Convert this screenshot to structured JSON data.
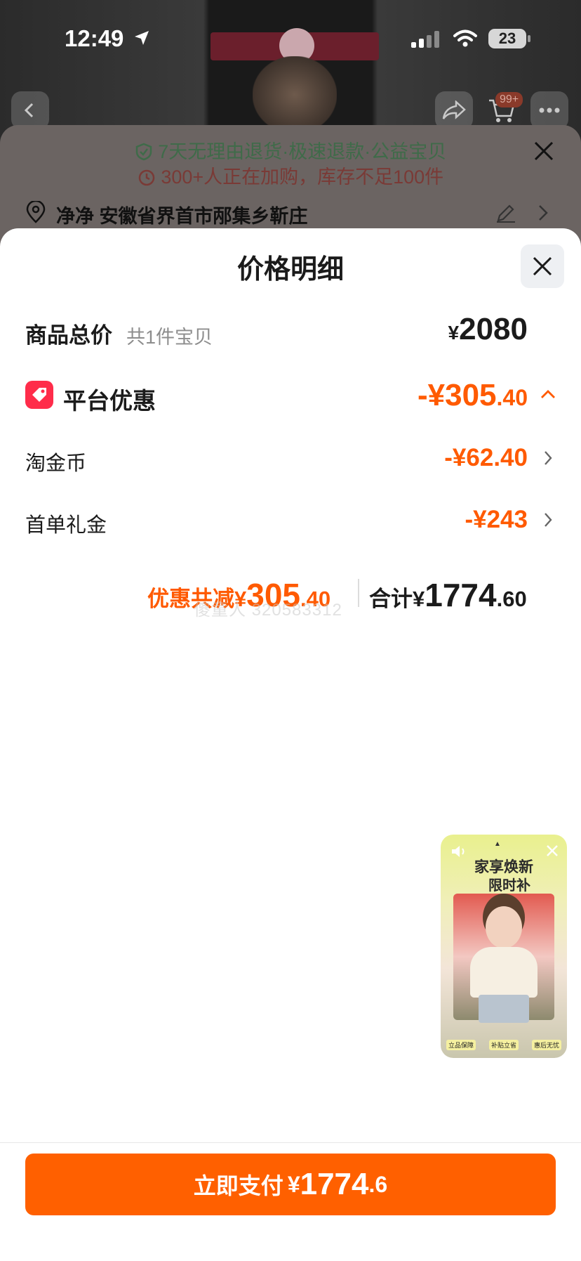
{
  "status_bar": {
    "time": "12:49",
    "battery": "23"
  },
  "top_nav": {
    "cart_badge": "99+"
  },
  "under_sheet": {
    "promise": "7天无理由退货·极速退款·公益宝贝",
    "urgency": "300+人正在加购，库存不足100件",
    "address": "净净 安徽省界首市邴集乡靳庄"
  },
  "panel": {
    "title": "价格明细",
    "total": {
      "label": "商品总价",
      "sub": "共1件宝贝",
      "yen": "¥",
      "value": "2080"
    },
    "platform_discount": {
      "label": "平台优惠",
      "prefix": "-¥",
      "int": "305",
      "dec": ".40"
    },
    "items": [
      {
        "label": "淘金币",
        "value": "-¥62.40"
      },
      {
        "label": "首单礼金",
        "value": "-¥243"
      }
    ],
    "summary": {
      "discount_prefix": "优惠共减¥",
      "discount_int": "305",
      "discount_dec": ".40",
      "total_prefix": "合计¥",
      "total_int": "1774",
      "total_dec": ".60"
    },
    "watermark": "傻童人 320583312"
  },
  "float_card": {
    "title_line1": "家享焕新",
    "title_line2": "限时补",
    "tags": [
      "立品保障",
      "补贴立省",
      "惠后无忧"
    ]
  },
  "pay_button": {
    "label": "立即支付",
    "yen": "¥",
    "int": "1774",
    "dec": ".6"
  },
  "colors": {
    "accent": "#ff6000",
    "discount": "#ff5a00",
    "promo_icon": "#ff2c4a"
  }
}
